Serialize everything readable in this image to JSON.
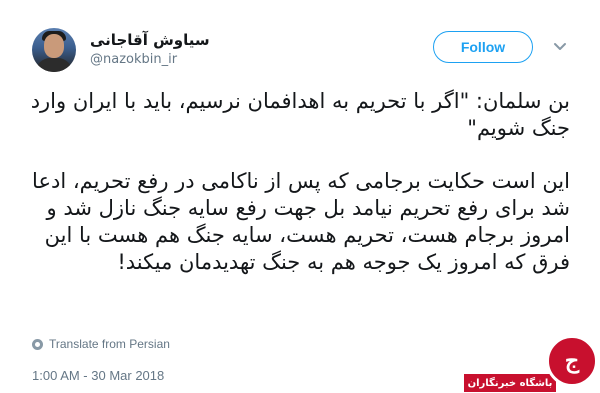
{
  "user": {
    "display_name": "سیاوش آقاجانی",
    "handle": "@nazokbin_ir",
    "avatar_icon": "avatar"
  },
  "actions": {
    "follow_label": "Follow",
    "more_icon": "chevron-down-icon"
  },
  "tweet": {
    "paragraph1": "بن سلمان: \"اگر با تحریم به اهدافمان نرسیم، باید با ایران وارد جنگ شویم\"",
    "paragraph2": "این است حکایت برجامی که پس از ناکامی در رفع تحریم، ادعا شد برای رفع تحریم نیامد بل جهت رفع سایه جنگ نازل شد و امروز برجام هست، تحریم هست، سایه جنگ هم هست با این فرق که امروز یک جوجه هم به جنگ تهدیدمان میکند!"
  },
  "translate": {
    "label": "Translate from Persian",
    "icon": "globe-icon"
  },
  "timestamp": "1:00 AM - 30 Mar 2018",
  "watermark": {
    "logo_glyph": "ج",
    "label": "باشگاه خبرنگاران"
  },
  "colors": {
    "accent": "#1da1f2",
    "text": "#14171a",
    "muted": "#657786",
    "brand_red": "#c8102e"
  }
}
